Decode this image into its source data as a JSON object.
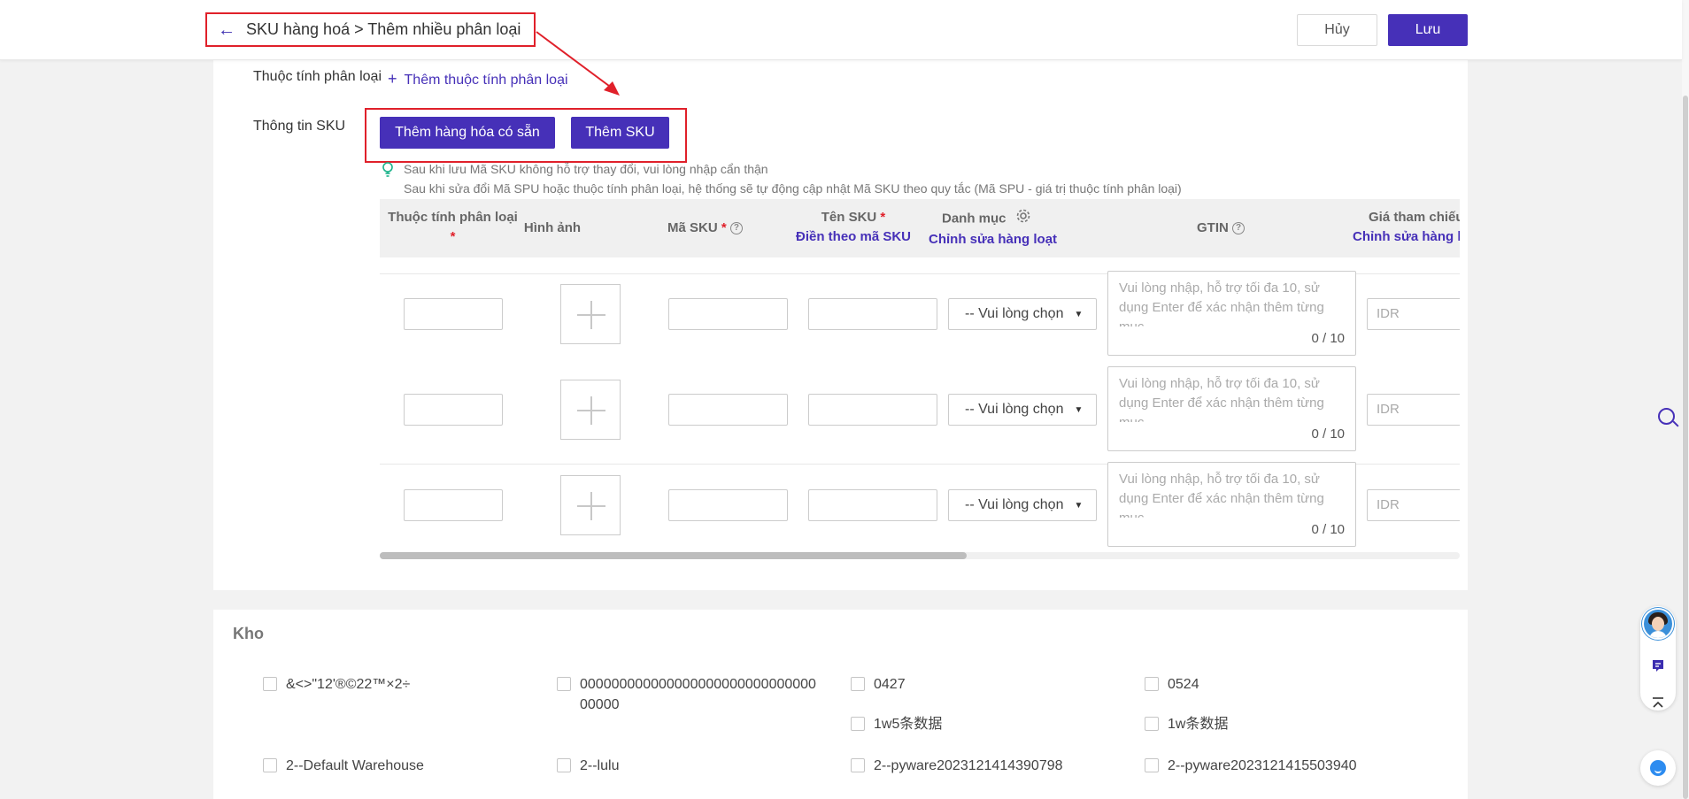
{
  "header": {
    "breadcrumb": "SKU hàng hoá > Thêm nhiều phân loại",
    "back_icon": "arrow-left-icon",
    "cancel_label": "Hủy",
    "save_label": "Lưu"
  },
  "form": {
    "attr_label": "Thuộc tính phân loại",
    "add_attr_label": "Thêm thuộc tính phân loại",
    "sku_info_label": "Thông tin SKU",
    "add_existing_label": "Thêm hàng hóa có sẵn",
    "add_sku_label": "Thêm SKU",
    "tip_line1": "Sau khi lưu Mã SKU không hỗ trợ thay đổi, vui lòng nhập cẩn thận",
    "tip_line2": "Sau khi sửa đổi Mã SPU hoặc thuộc tính phân loại, hệ thống sẽ tự động cập nhật Mã SKU theo quy tắc (Mã SPU - giá trị thuộc tính phân loại)"
  },
  "table": {
    "headers": {
      "attr": "Thuộc tính phân loại",
      "image": "Hình ảnh",
      "sku_code": "Mã SKU",
      "sku_name": "Tên SKU",
      "sku_name_sub": "Điền theo mã SKU",
      "category": "Danh mục",
      "category_sub": "Chỉnh sửa hàng loạt",
      "gtin": "GTIN",
      "price": "Giá tham chiếu",
      "price_sub": "Chỉnh sửa hàng loạt"
    },
    "rows": [
      {
        "select": "-- Vui lòng chọn",
        "gtin_placeholder": "Vui lòng nhập, hỗ trợ tối đa 10, sử dụng Enter để xác nhận thêm từng mục",
        "gtin_count": "0 / 10",
        "price_placeholder": "IDR"
      },
      {
        "select": "-- Vui lòng chọn",
        "gtin_placeholder": "Vui lòng nhập, hỗ trợ tối đa 10, sử dụng Enter để xác nhận thêm từng mục",
        "gtin_count": "0 / 10",
        "price_placeholder": "IDR"
      },
      {
        "select": "-- Vui lòng chọn",
        "gtin_placeholder": "Vui lòng nhập, hỗ trợ tối đa 10, sử dụng Enter để xác nhận thêm từng mục",
        "gtin_count": "0 / 10",
        "price_placeholder": "IDR"
      }
    ]
  },
  "warehouse": {
    "title": "Kho",
    "items": [
      "&<>\"12'®©22™×2÷",
      "00000000000000000000000000000000000",
      "0427",
      "0524",
      "1w5条数据",
      "1w条数据",
      "2--Default Warehouse",
      "2--lulu",
      "2--pyware2023121414390798",
      "2--pyware2023121415503940"
    ]
  },
  "colors": {
    "primary": "#4630b8",
    "highlight": "#e0202a",
    "required": "#e0202a",
    "tip": "#1bb38a"
  }
}
